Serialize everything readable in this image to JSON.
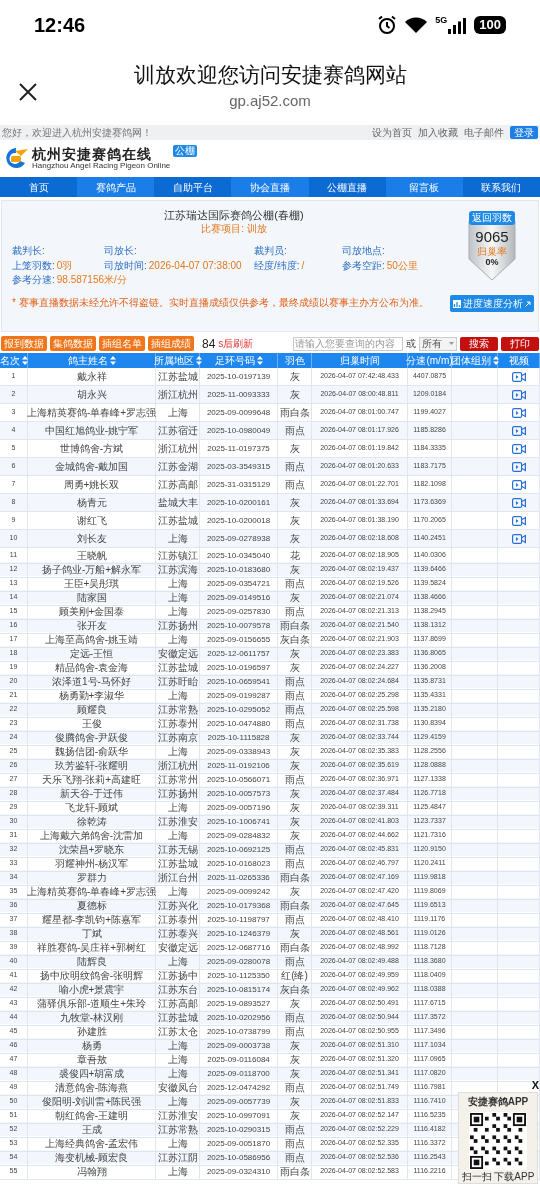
{
  "status_bar": {
    "time": "12:46",
    "network": "5G",
    "battery": "100"
  },
  "browser": {
    "title": "训放欢迎您访问安捷赛鸽网站",
    "url": "gp.aj52.com"
  },
  "top_strip": {
    "greeting": "您好，欢迎进入杭州安捷赛鸽网！",
    "links": [
      "设为首页",
      "加入收藏",
      "电子邮件"
    ],
    "login": "登录"
  },
  "logo": {
    "name": "杭州安捷赛鸽在线",
    "english": "Hangzhou Angel Racing Pigeon Online",
    "badge": "公棚"
  },
  "nav": [
    "首页",
    "赛鸽产品",
    "自助平台",
    "协会直播",
    "公棚直播",
    "留言板",
    "联系我们"
  ],
  "race": {
    "title": "江苏瑞达国际赛鸽公棚(春棚)",
    "subtitle": "比赛项目: 训放",
    "fields": [
      {
        "label": "裁判长:"
      },
      {
        "label": "司放长:"
      },
      {
        "label": "裁判员:"
      },
      {
        "label": "司放地点:"
      },
      {
        "label": "上笼羽数:",
        "value": "0羽"
      },
      {
        "label": "司放时间:",
        "value": "2026-04-07 07:38:00"
      },
      {
        "label": "经度/纬度:",
        "value": "/"
      },
      {
        "label": "参考空距:",
        "value": "50公里"
      },
      {
        "label": "参考分速:",
        "value": "98.587156米/分"
      }
    ],
    "notice": "* 赛事直播数据未经允许不得盗链。实时直播成绩仅供参考，最终成绩以赛事主办方公布为准。",
    "returned": {
      "ribbon": "返回羽数",
      "count": "9065",
      "rate_label": "归巢率",
      "rate": "0%"
    },
    "analysis_button": "进度速度分析"
  },
  "toolbar": {
    "buttons": [
      "报到数据",
      "集鸽数据",
      "插组名单",
      "插组成绩"
    ],
    "countdown": "84",
    "countdown_label": "s后刷新",
    "search_placeholder": "请输入您要查询的内容",
    "or": "或",
    "filter": "所有",
    "search": "搜索",
    "print": "打印"
  },
  "table": {
    "columns": [
      {
        "label": "名次",
        "sortable": true
      },
      {
        "label": "鸽主姓名",
        "sortable": true
      },
      {
        "label": "所属地区",
        "sortable": true
      },
      {
        "label": "足环号码",
        "sortable": true
      },
      {
        "label": "羽色",
        "sortable": false
      },
      {
        "label": "归巢时间",
        "sortable": false
      },
      {
        "label": "分速(m/m)",
        "sortable": false
      },
      {
        "label": "团体组别",
        "sortable": true
      },
      {
        "label": "视频",
        "sortable": false
      }
    ],
    "rows": [
      {
        "rank": "1",
        "name": "戴永祥",
        "region": "江苏盐城",
        "ring": "2025-10-0197139",
        "plumage": "灰",
        "time": "2026-04-07 07:42:48.433",
        "speed": "4407.0875",
        "video": true
      },
      {
        "rank": "2",
        "name": "胡永兴",
        "region": "浙江杭州",
        "ring": "2025-11-0093333",
        "plumage": "灰",
        "time": "2026-04-07 08:00:48.811",
        "speed": "1209.0184",
        "video": true
      },
      {
        "rank": "3",
        "name": "上海精英赛鸽-单春峰+罗志强",
        "region": "上海",
        "ring": "2025-09-0099648",
        "plumage": "雨白条",
        "time": "2026-04-07 08:01:00.747",
        "speed": "1199.4027",
        "video": true
      },
      {
        "rank": "4",
        "name": "中国红旭鸽业-姚宁军",
        "region": "江苏宿迁",
        "ring": "2025-10-0980049",
        "plumage": "雨点",
        "time": "2026-04-07 08:01:17.926",
        "speed": "1185.8286",
        "video": true
      },
      {
        "rank": "5",
        "name": "世博鸽舍-方斌",
        "region": "浙江杭州",
        "ring": "2025-11-0197375",
        "plumage": "灰",
        "time": "2026-04-07 08:01:19.842",
        "speed": "1184.3335",
        "video": true
      },
      {
        "rank": "6",
        "name": "金城鸽舍-戴加国",
        "region": "江苏金湖",
        "ring": "2025-03-3549315",
        "plumage": "雨点",
        "time": "2026-04-07 08:01:20.633",
        "speed": "1183.7175",
        "video": true
      },
      {
        "rank": "7",
        "name": "周勇+姚长双",
        "region": "江苏高邮",
        "ring": "2025-31-0315129",
        "plumage": "雨点",
        "time": "2026-04-07 08:01:22.701",
        "speed": "1182.1098",
        "video": true
      },
      {
        "rank": "8",
        "name": "杨青元",
        "region": "盐城大丰",
        "ring": "2025-10-0200161",
        "plumage": "灰",
        "time": "2026-04-07 08:01:33.694",
        "speed": "1173.6369",
        "video": true
      },
      {
        "rank": "9",
        "name": "谢红飞",
        "region": "江苏盐城",
        "ring": "2025-10-0200018",
        "plumage": "灰",
        "time": "2026-04-07 08:01:38.190",
        "speed": "1170.2065",
        "video": true
      },
      {
        "rank": "10",
        "name": "刘长友",
        "region": "上海",
        "ring": "2025-09-0278938",
        "plumage": "灰",
        "time": "2026-04-07 08:02:18.608",
        "speed": "1140.2451",
        "video": true
      },
      {
        "rank": "11",
        "name": "王晓帆",
        "region": "江苏镇江",
        "ring": "2025-10-0345040",
        "plumage": "花",
        "time": "2026-04-07 08:02:18.905",
        "speed": "1140.0306",
        "video": false
      },
      {
        "rank": "12",
        "name": "扬子鸽业-万船+解永军",
        "region": "江苏滨海",
        "ring": "2025-10-0183680",
        "plumage": "灰",
        "time": "2026-04-07 08:02:19.437",
        "speed": "1139.6466",
        "video": false
      },
      {
        "rank": "13",
        "name": "王臣+吴彤琪",
        "region": "上海",
        "ring": "2025-09-0354721",
        "plumage": "雨点",
        "time": "2026-04-07 08:02:19.526",
        "speed": "1139.5824",
        "video": false
      },
      {
        "rank": "14",
        "name": "陆家国",
        "region": "上海",
        "ring": "2025-09-0149516",
        "plumage": "灰",
        "time": "2026-04-07 08:02:21.074",
        "speed": "1138.4666",
        "video": false
      },
      {
        "rank": "15",
        "name": "顾美刚+金国泰",
        "region": "上海",
        "ring": "2025-09-0257830",
        "plumage": "雨点",
        "time": "2026-04-07 08:02:21.313",
        "speed": "1138.2945",
        "video": false
      },
      {
        "rank": "16",
        "name": "张开友",
        "region": "江苏扬州",
        "ring": "2025-10-0079578",
        "plumage": "雨白条",
        "time": "2026-04-07 08:02:21.540",
        "speed": "1138.1312",
        "video": false
      },
      {
        "rank": "17",
        "name": "上海至高鸽舍-姚玉靖",
        "region": "上海",
        "ring": "2025-09-0156655",
        "plumage": "灰白条",
        "time": "2026-04-07 08:02:21.903",
        "speed": "1137.8699",
        "video": false
      },
      {
        "rank": "18",
        "name": "定远-王恒",
        "region": "安徽定远",
        "ring": "2025-12-0611757",
        "plumage": "灰",
        "time": "2026-04-07 08:02:23.383",
        "speed": "1136.8065",
        "video": false
      },
      {
        "rank": "19",
        "name": "精品鸽舍-袁金海",
        "region": "江苏盐城",
        "ring": "2025-10-0196597",
        "plumage": "灰",
        "time": "2026-04-07 08:02:24.227",
        "speed": "1136.2008",
        "video": false
      },
      {
        "rank": "20",
        "name": "浓泽道1号-马怀好",
        "region": "江苏盱眙",
        "ring": "2025-10-0659541",
        "plumage": "雨点",
        "time": "2026-04-07 08:02:24.684",
        "speed": "1135.8731",
        "video": false
      },
      {
        "rank": "21",
        "name": "杨勇勤+李淑华",
        "region": "上海",
        "ring": "2025-09-0199287",
        "plumage": "雨点",
        "time": "2026-04-07 08:02:25.298",
        "speed": "1135.4331",
        "video": false
      },
      {
        "rank": "22",
        "name": "顾耀良",
        "region": "江苏常熟",
        "ring": "2025-10-0295052",
        "plumage": "雨点",
        "time": "2026-04-07 08:02:25.598",
        "speed": "1135.2180",
        "video": false
      },
      {
        "rank": "23",
        "name": "王俊",
        "region": "江苏泰州",
        "ring": "2025-10-0474880",
        "plumage": "雨点",
        "time": "2026-04-07 08:02:31.738",
        "speed": "1130.8394",
        "video": false
      },
      {
        "rank": "24",
        "name": "俊腾鸽舍-尹跃俊",
        "region": "江苏南京",
        "ring": "2025-10-1115828",
        "plumage": "灰",
        "time": "2026-04-07 08:02:33.744",
        "speed": "1129.4159",
        "video": false
      },
      {
        "rank": "25",
        "name": "魏扬信团-俞跃华",
        "region": "上海",
        "ring": "2025-09-0338943",
        "plumage": "灰",
        "time": "2026-04-07 08:02:35.383",
        "speed": "1128.2556",
        "video": false
      },
      {
        "rank": "26",
        "name": "玖芳鉴轩-张耀明",
        "region": "浙江杭州",
        "ring": "2025-11-0192106",
        "plumage": "灰",
        "time": "2026-04-07 08:02:35.619",
        "speed": "1128.0888",
        "video": false
      },
      {
        "rank": "27",
        "name": "天乐飞翔-张莉+高建旺",
        "region": "江苏常州",
        "ring": "2025-10-0566071",
        "plumage": "雨点",
        "time": "2026-04-07 08:02:36.971",
        "speed": "1127.1338",
        "video": false
      },
      {
        "rank": "28",
        "name": "新天谷-于迁伟",
        "region": "江苏扬州",
        "ring": "2025-10-0057573",
        "plumage": "灰",
        "time": "2026-04-07 08:02:37.484",
        "speed": "1126.7718",
        "video": false
      },
      {
        "rank": "29",
        "name": "飞龙轩-顾斌",
        "region": "上海",
        "ring": "2025-09-0057196",
        "plumage": "灰",
        "time": "2026-04-07 08:02:39.311",
        "speed": "1125.4847",
        "video": false
      },
      {
        "rank": "30",
        "name": "徐乾涛",
        "region": "江苏淮安",
        "ring": "2025-10-1006741",
        "plumage": "灰",
        "time": "2026-04-07 08:02:41.803",
        "speed": "1123.7337",
        "video": false
      },
      {
        "rank": "31",
        "name": "上海戴六弟鸽舍-沈雷加",
        "region": "上海",
        "ring": "2025-09-0284832",
        "plumage": "灰",
        "time": "2026-04-07 08:02:44.662",
        "speed": "1121.7316",
        "video": false
      },
      {
        "rank": "32",
        "name": "沈荣昌+罗晓东",
        "region": "江苏无锡",
        "ring": "2025-10-0692125",
        "plumage": "雨点",
        "time": "2026-04-07 08:02:45.831",
        "speed": "1120.9150",
        "video": false
      },
      {
        "rank": "33",
        "name": "羽耀神州-杨汉军",
        "region": "江苏盐城",
        "ring": "2025-10-0168023",
        "plumage": "雨点",
        "time": "2026-04-07 08:02:46.797",
        "speed": "1120.2411",
        "video": false
      },
      {
        "rank": "34",
        "name": "罗群力",
        "region": "浙江台州",
        "ring": "2025-11-0265336",
        "plumage": "雨白条",
        "time": "2026-04-07 08:02:47.169",
        "speed": "1119.9818",
        "video": false
      },
      {
        "rank": "35",
        "name": "上海精英赛鸽-单春峰+罗志强",
        "region": "上海",
        "ring": "2025-09-0099242",
        "plumage": "灰",
        "time": "2026-04-07 08:02:47.420",
        "speed": "1119.8069",
        "video": false
      },
      {
        "rank": "36",
        "name": "夏德标",
        "region": "江苏兴化",
        "ring": "2025-10-0179368",
        "plumage": "雨白条",
        "time": "2026-04-07 08:02:47.645",
        "speed": "1119.6513",
        "video": false
      },
      {
        "rank": "37",
        "name": "耀星都-李凯钧+陈嘉军",
        "region": "江苏泰州",
        "ring": "2025-10-1198797",
        "plumage": "雨点",
        "time": "2026-04-07 08:02:48.410",
        "speed": "1119.1176",
        "video": false
      },
      {
        "rank": "38",
        "name": "丁斌",
        "region": "江苏泰兴",
        "ring": "2025-10-1246379",
        "plumage": "灰",
        "time": "2026-04-07 08:02:48.561",
        "speed": "1119.0126",
        "video": false
      },
      {
        "rank": "39",
        "name": "祥胜赛鸽-吴庄祥+郭树红",
        "region": "安徽定远",
        "ring": "2025-12-0687716",
        "plumage": "雨白条",
        "time": "2026-04-07 08:02:48.992",
        "speed": "1118.7128",
        "video": false
      },
      {
        "rank": "40",
        "name": "陆辉良",
        "region": "上海",
        "ring": "2025-09-0280078",
        "plumage": "雨点",
        "time": "2026-04-07 08:02:49.488",
        "speed": "1118.3680",
        "video": false
      },
      {
        "rank": "41",
        "name": "扬中欣明纹鸽舍-张明辉",
        "region": "江苏扬中",
        "ring": "2025-10-1125350",
        "plumage": "红(绛)",
        "time": "2026-04-07 08:02:49.959",
        "speed": "1118.0409",
        "video": false
      },
      {
        "rank": "42",
        "name": "喻小虎+景震宇",
        "region": "江苏东台",
        "ring": "2025-10-0815174",
        "plumage": "灰白条",
        "time": "2026-04-07 08:02:49.962",
        "speed": "1118.0388",
        "video": false
      },
      {
        "rank": "43",
        "name": "蒲驿俱乐部-道顺生+朱玲",
        "region": "江苏高邮",
        "ring": "2025-19-0893527",
        "plumage": "灰",
        "time": "2026-04-07 08:02:50.491",
        "speed": "1117.6715",
        "video": false
      },
      {
        "rank": "44",
        "name": "九牧堂-林汉刚",
        "region": "江苏盐城",
        "ring": "2025-10-0202956",
        "plumage": "雨点",
        "time": "2026-04-07 08:02:50.944",
        "speed": "1117.3572",
        "video": false
      },
      {
        "rank": "45",
        "name": "孙建胜",
        "region": "江苏太仓",
        "ring": "2025-10-0738799",
        "plumage": "雨点",
        "time": "2026-04-07 08:02:50.955",
        "speed": "1117.3496",
        "video": false
      },
      {
        "rank": "46",
        "name": "杨勇",
        "region": "上海",
        "ring": "2025-09-0003738",
        "plumage": "灰",
        "time": "2026-04-07 08:02:51.310",
        "speed": "1117.1034",
        "video": false
      },
      {
        "rank": "47",
        "name": "章吾敖",
        "region": "上海",
        "ring": "2025-09-0116084",
        "plumage": "灰",
        "time": "2026-04-07 08:02:51.320",
        "speed": "1117.0965",
        "video": false
      },
      {
        "rank": "48",
        "name": "裘俊四+胡富成",
        "region": "上海",
        "ring": "2025-09-0118700",
        "plumage": "灰",
        "time": "2026-04-07 08:02:51.341",
        "speed": "1117.0820",
        "video": false
      },
      {
        "rank": "49",
        "name": "清意鸽舍-陈海燕",
        "region": "安徽凤台",
        "ring": "2025-12-0474292",
        "plumage": "雨点",
        "time": "2026-04-07 08:02:51.749",
        "speed": "1116.7981",
        "video": false
      },
      {
        "rank": "50",
        "name": "俊阳明-刘训雷+陈民强",
        "region": "上海",
        "ring": "2025-09-0057739",
        "plumage": "灰",
        "time": "2026-04-07 08:02:51.833",
        "speed": "1116.7410",
        "video": false
      },
      {
        "rank": "51",
        "name": "朝红鸽舍-王建明",
        "region": "江苏淮安",
        "ring": "2025-10-0997091",
        "plumage": "灰",
        "time": "2026-04-07 08:02:52.147",
        "speed": "1116.5235",
        "video": false
      },
      {
        "rank": "52",
        "name": "王成",
        "region": "江苏常熟",
        "ring": "2025-10-0290315",
        "plumage": "雨点",
        "time": "2026-04-07 08:02:52.229",
        "speed": "1116.4182",
        "video": false
      },
      {
        "rank": "53",
        "name": "上海经典鸽舍-孟宏伟",
        "region": "上海",
        "ring": "2025-09-0051870",
        "plumage": "雨点",
        "time": "2026-04-07 08:02:52.335",
        "speed": "1116.3372",
        "video": false
      },
      {
        "rank": "54",
        "name": "海变机械-顾宏良",
        "region": "江苏江阴",
        "ring": "2025-10-0586956",
        "plumage": "雨点",
        "time": "2026-04-07 08:02:52.536",
        "speed": "1116.2543",
        "video": false
      },
      {
        "rank": "55",
        "name": "冯翰翔",
        "region": "上海",
        "ring": "2025-09-0324310",
        "plumage": "雨白条",
        "time": "2026-04-07 08:02:52.583",
        "speed": "1116.2216",
        "video": false
      }
    ]
  },
  "app_ad": {
    "title": "安捷赛鸽APP",
    "caption": "扫一扫 下载APP",
    "close": "X"
  }
}
